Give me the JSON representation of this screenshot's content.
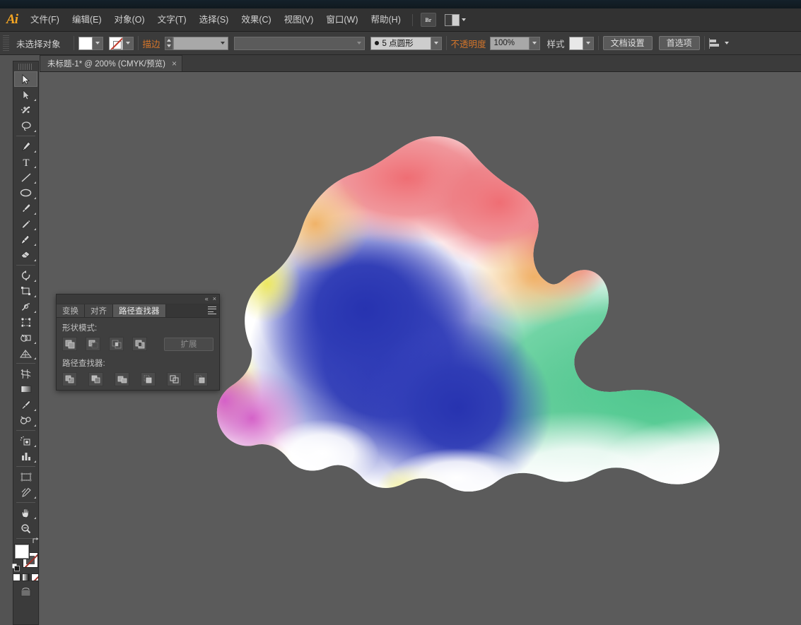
{
  "app": {
    "name": "Adobe Illustrator",
    "logo_text": "Ai"
  },
  "menubar": {
    "items": [
      {
        "label": "文件(F)",
        "name": "menu-file"
      },
      {
        "label": "编辑(E)",
        "name": "menu-edit"
      },
      {
        "label": "对象(O)",
        "name": "menu-object"
      },
      {
        "label": "文字(T)",
        "name": "menu-type"
      },
      {
        "label": "选择(S)",
        "name": "menu-select"
      },
      {
        "label": "效果(C)",
        "name": "menu-effect"
      },
      {
        "label": "视图(V)",
        "name": "menu-view"
      },
      {
        "label": "窗口(W)",
        "name": "menu-window"
      },
      {
        "label": "帮助(H)",
        "name": "menu-help"
      }
    ],
    "bridge_label": "Br",
    "workspace_label": ""
  },
  "controlbar": {
    "selection_status": "未选择对象",
    "fill_label": "填色",
    "stroke_label": "描边",
    "stroke_weight_value": "",
    "variable_width_value": "",
    "brush_definition": "5 点圆形",
    "opacity_label": "不透明度",
    "opacity_value": "100%",
    "style_label": "样式",
    "document_setup": "文档设置",
    "preferences": "首选项"
  },
  "document_tab": {
    "title": "未标题-1* @ 200% (CMYK/预览)",
    "close": "×",
    "zoom": "200%",
    "color_mode": "CMYK/预览"
  },
  "toolbox": {
    "tools": [
      {
        "name": "selection-tool",
        "label": "选择工具",
        "active": true
      },
      {
        "name": "direct-selection-tool",
        "label": "直接选择工具",
        "active": false
      },
      {
        "name": "magic-wand-tool",
        "label": "魔棒工具",
        "active": false
      },
      {
        "name": "lasso-tool",
        "label": "套索工具",
        "active": false
      },
      {
        "name": "pen-tool",
        "label": "钢笔工具",
        "active": false
      },
      {
        "name": "type-tool",
        "label": "文字工具",
        "active": false
      },
      {
        "name": "line-segment-tool",
        "label": "直线段工具",
        "active": false
      },
      {
        "name": "ellipse-tool",
        "label": "椭圆工具",
        "active": false
      },
      {
        "name": "paintbrush-tool",
        "label": "画笔工具",
        "active": false
      },
      {
        "name": "pencil-tool",
        "label": "铅笔工具",
        "active": false
      },
      {
        "name": "blob-brush-tool",
        "label": "斑点画笔工具",
        "active": false
      },
      {
        "name": "eraser-tool",
        "label": "橡皮擦工具",
        "active": false
      },
      {
        "name": "rotate-tool",
        "label": "旋转工具",
        "active": false
      },
      {
        "name": "scale-tool",
        "label": "比例缩放工具",
        "active": false
      },
      {
        "name": "width-tool",
        "label": "宽度工具",
        "active": false
      },
      {
        "name": "free-transform-tool",
        "label": "自由变换工具",
        "active": false
      },
      {
        "name": "shape-builder-tool",
        "label": "形状生成器工具",
        "active": false
      },
      {
        "name": "perspective-grid-tool",
        "label": "透视网格工具",
        "active": false
      },
      {
        "name": "mesh-tool",
        "label": "网格工具",
        "active": false
      },
      {
        "name": "gradient-tool",
        "label": "渐变工具",
        "active": false
      },
      {
        "name": "eyedropper-tool",
        "label": "吸管工具",
        "active": false
      },
      {
        "name": "blend-tool",
        "label": "混合工具",
        "active": false
      },
      {
        "name": "symbol-sprayer-tool",
        "label": "符号喷枪工具",
        "active": false
      },
      {
        "name": "column-graph-tool",
        "label": "柱形图工具",
        "active": false
      },
      {
        "name": "artboard-tool",
        "label": "画板工具",
        "active": false
      },
      {
        "name": "slice-tool",
        "label": "切片工具",
        "active": false
      },
      {
        "name": "hand-tool",
        "label": "抓手工具",
        "active": false
      },
      {
        "name": "zoom-tool",
        "label": "缩放工具",
        "active": false
      }
    ],
    "fill_color": "#ffffff",
    "stroke_color": "none",
    "swatches": [
      "白色",
      "渐变",
      "无"
    ]
  },
  "pathfinder_panel": {
    "tabs": [
      {
        "label": "变换",
        "active": false
      },
      {
        "label": "对齐",
        "active": false
      },
      {
        "label": "路径查找器",
        "active": true
      }
    ],
    "collapse": "«",
    "close": "×",
    "shape_modes_label": "形状模式:",
    "shape_modes": [
      {
        "name": "unite",
        "label": "联集"
      },
      {
        "name": "minus-front",
        "label": "减去顶层"
      },
      {
        "name": "intersect",
        "label": "交集"
      },
      {
        "name": "exclude",
        "label": "差集"
      }
    ],
    "expand_label": "扩展",
    "pathfinders_label": "路径查找器:",
    "pathfinders": [
      {
        "name": "divide",
        "label": "分割"
      },
      {
        "name": "trim",
        "label": "修边"
      },
      {
        "name": "merge",
        "label": "合并"
      },
      {
        "name": "crop",
        "label": "裁剪"
      },
      {
        "name": "outline",
        "label": "轮廓"
      },
      {
        "name": "minus-back",
        "label": "减去后方对象"
      }
    ]
  },
  "canvas": {
    "background_color": "#5b5b5b",
    "artwork_name": "gradient-mesh-blob",
    "artwork_colors": [
      "#e8707a",
      "#f0b070",
      "#e8e070",
      "#3a43b4",
      "#c060c0",
      "#ffffff",
      "#60c890"
    ]
  },
  "colors": {
    "menubar_bg": "#323232",
    "controlbar_bg": "#3b3b3b",
    "panel_bg": "#3f3f3f",
    "canvas_bg": "#5b5b5b",
    "accent_orange": "#d4752a",
    "logo_orange": "#f5a623"
  }
}
